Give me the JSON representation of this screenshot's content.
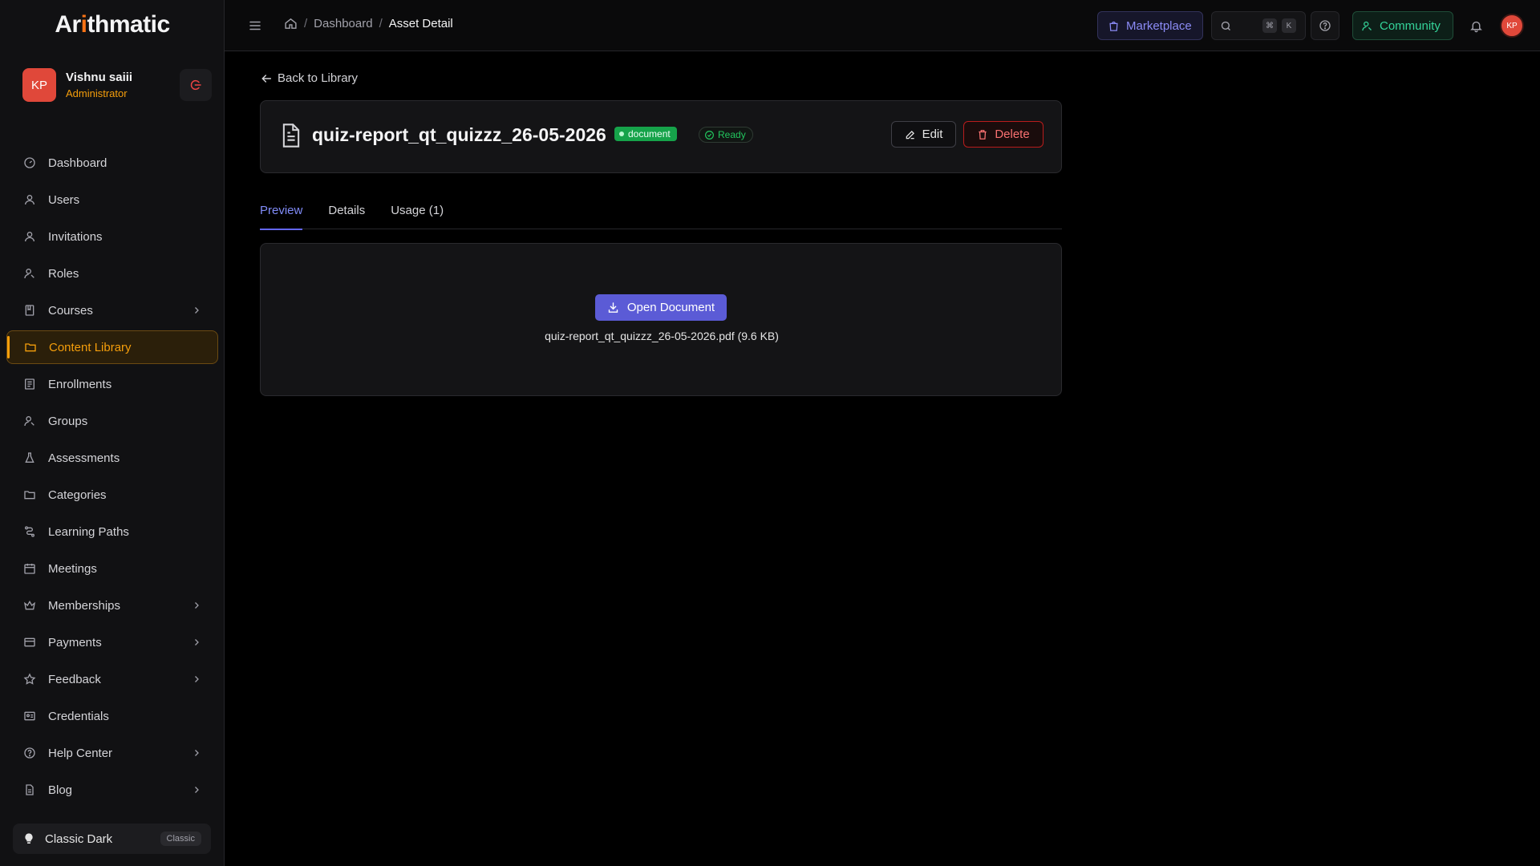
{
  "app": {
    "logo_prefix": "Ar",
    "logo_accent": "i",
    "logo_suffix": "thmatic"
  },
  "user": {
    "initials": "KP",
    "name": "Vishnu saiii",
    "role": "Administrator"
  },
  "sidebar": {
    "items": [
      {
        "label": "Dashboard",
        "icon": "dashboard-icon",
        "has_chevron": false
      },
      {
        "label": "Users",
        "icon": "user-icon",
        "has_chevron": false
      },
      {
        "label": "Invitations",
        "icon": "user-icon",
        "has_chevron": false
      },
      {
        "label": "Roles",
        "icon": "roles-icon",
        "has_chevron": false
      },
      {
        "label": "Courses",
        "icon": "book-icon",
        "has_chevron": true
      },
      {
        "label": "Content Library",
        "icon": "folder-icon",
        "has_chevron": false,
        "active": true
      },
      {
        "label": "Enrollments",
        "icon": "list-icon",
        "has_chevron": false
      },
      {
        "label": "Groups",
        "icon": "groups-icon",
        "has_chevron": false
      },
      {
        "label": "Assessments",
        "icon": "flask-icon",
        "has_chevron": false
      },
      {
        "label": "Categories",
        "icon": "folder-icon",
        "has_chevron": false
      },
      {
        "label": "Learning Paths",
        "icon": "route-icon",
        "has_chevron": false
      },
      {
        "label": "Meetings",
        "icon": "calendar-icon",
        "has_chevron": false
      },
      {
        "label": "Memberships",
        "icon": "crown-icon",
        "has_chevron": true
      },
      {
        "label": "Payments",
        "icon": "card-icon",
        "has_chevron": true
      },
      {
        "label": "Feedback",
        "icon": "star-icon",
        "has_chevron": true
      },
      {
        "label": "Credentials",
        "icon": "id-card-icon",
        "has_chevron": false
      },
      {
        "label": "Help Center",
        "icon": "help-circle-icon",
        "has_chevron": true
      },
      {
        "label": "Blog",
        "icon": "document-icon",
        "has_chevron": true
      }
    ],
    "theme_label": "Classic Dark",
    "theme_badge": "Classic"
  },
  "topbar": {
    "breadcrumb": [
      "Dashboard",
      "Asset Detail"
    ],
    "marketplace_label": "Marketplace",
    "search_kbd_1": "⌘",
    "search_kbd_2": "K",
    "community_label": "Community",
    "avatar_initials": "KP"
  },
  "asset": {
    "back_label": "Back to Library",
    "title": "quiz-report_qt_quizzz_26-05-2026",
    "type": "document",
    "status": "Ready",
    "edit_label": "Edit",
    "delete_label": "Delete"
  },
  "tabs": [
    {
      "label": "Preview",
      "active": true
    },
    {
      "label": "Details",
      "active": false
    },
    {
      "label": "Usage (1)",
      "active": false
    }
  ],
  "preview": {
    "open_label": "Open Document",
    "file_info": "quiz-report_qt_quizzz_26-05-2026.pdf (9.6 KB)"
  },
  "colors": {
    "accent": "#f59e0b",
    "primary": "#5b5bd6",
    "danger": "#ef4444",
    "success": "#22c55e"
  }
}
